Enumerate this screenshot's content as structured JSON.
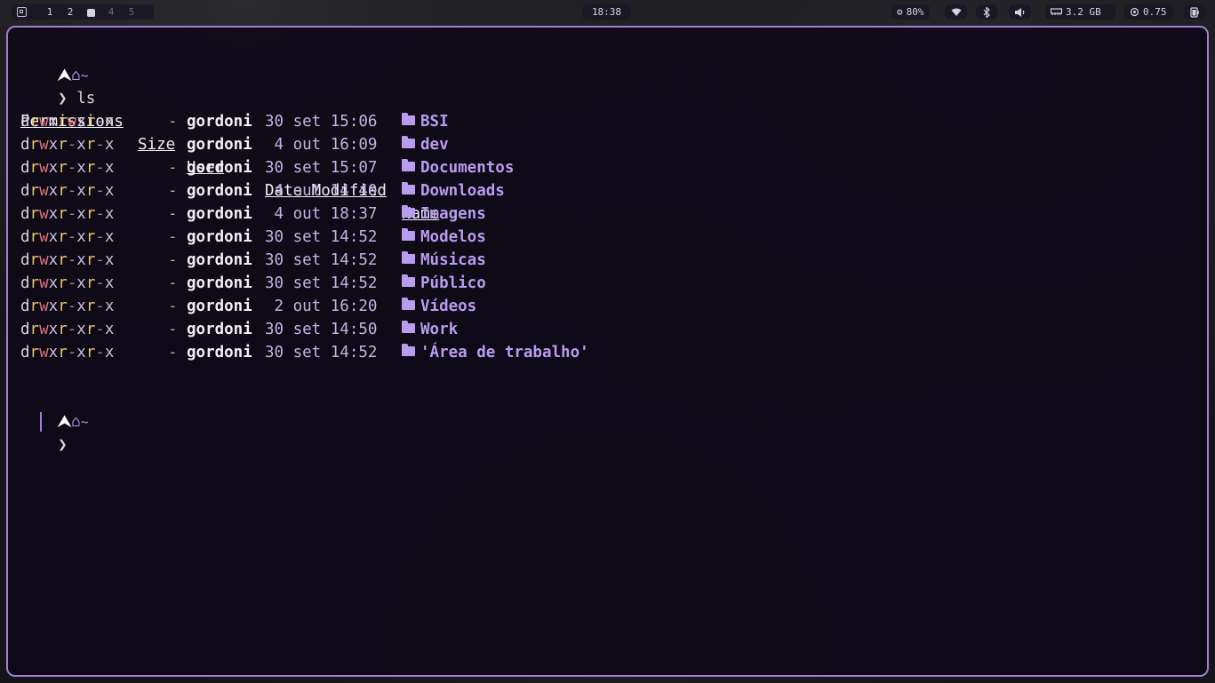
{
  "topbar": {
    "workspaces": [
      {
        "label": "1",
        "state": "normal"
      },
      {
        "label": "2",
        "state": "normal"
      },
      {
        "label": "",
        "state": "active"
      },
      {
        "label": "4",
        "state": "dim"
      },
      {
        "label": "5",
        "state": "dim"
      }
    ],
    "clock": "18:38",
    "brightness": "80%",
    "memory": "3.2 GB",
    "cpu_load": "0.75",
    "icons": {
      "launcher": "window-icon",
      "brightness": "sun-icon",
      "wifi": "wifi-icon",
      "bluetooth": "bluetooth-icon",
      "volume": "volume-icon",
      "memory": "memory-icon",
      "cpu": "cpu-icon",
      "battery": "battery-icon"
    }
  },
  "terminal": {
    "prompt": {
      "logo": "⮝",
      "home": "⌂",
      "path": "~",
      "chevron": "❯"
    },
    "command": "ls",
    "headers": {
      "permissions": "Permissions",
      "size": "Size",
      "user": "User",
      "date": "Date Modified",
      "name": "Name"
    },
    "rows": [
      {
        "perms": "drwxrwxr-x",
        "size": "-",
        "user": "gordoni",
        "date": "30 set 15:06",
        "name": "BSI",
        "icon": "folder"
      },
      {
        "perms": "drwxr-xr-x",
        "size": "-",
        "user": "gordoni",
        "date": " 4 out 16:09",
        "name": "dev",
        "icon": "folder"
      },
      {
        "perms": "drwxr-xr-x",
        "size": "-",
        "user": "gordoni",
        "date": "30 set 15:07",
        "name": "Documentos",
        "icon": "folder"
      },
      {
        "perms": "drwxr-xr-x",
        "size": "-",
        "user": "gordoni",
        "date": " 4 out 14:40",
        "name": "Downloads",
        "icon": "folder-download"
      },
      {
        "perms": "drwxr-xr-x",
        "size": "-",
        "user": "gordoni",
        "date": " 4 out 18:37",
        "name": "Imagens",
        "icon": "folder"
      },
      {
        "perms": "drwxr-xr-x",
        "size": "-",
        "user": "gordoni",
        "date": "30 set 14:52",
        "name": "Modelos",
        "icon": "folder-open"
      },
      {
        "perms": "drwxr-xr-x",
        "size": "-",
        "user": "gordoni",
        "date": "30 set 14:52",
        "name": "Músicas",
        "icon": "folder-open"
      },
      {
        "perms": "drwxr-xr-x",
        "size": "-",
        "user": "gordoni",
        "date": "30 set 14:52",
        "name": "Público",
        "icon": "folder-open"
      },
      {
        "perms": "drwxr-xr-x",
        "size": "-",
        "user": "gordoni",
        "date": " 2 out 16:20",
        "name": "Vídeos",
        "icon": "folder"
      },
      {
        "perms": "drwxr-xr-x",
        "size": "-",
        "user": "gordoni",
        "date": "30 set 14:50",
        "name": "Work",
        "icon": "folder"
      },
      {
        "perms": "drwxr-xr-x",
        "size": "-",
        "user": "gordoni",
        "date": "30 set 14:52",
        "name": "'Área de trabalho'",
        "icon": "folder-open"
      }
    ]
  }
}
